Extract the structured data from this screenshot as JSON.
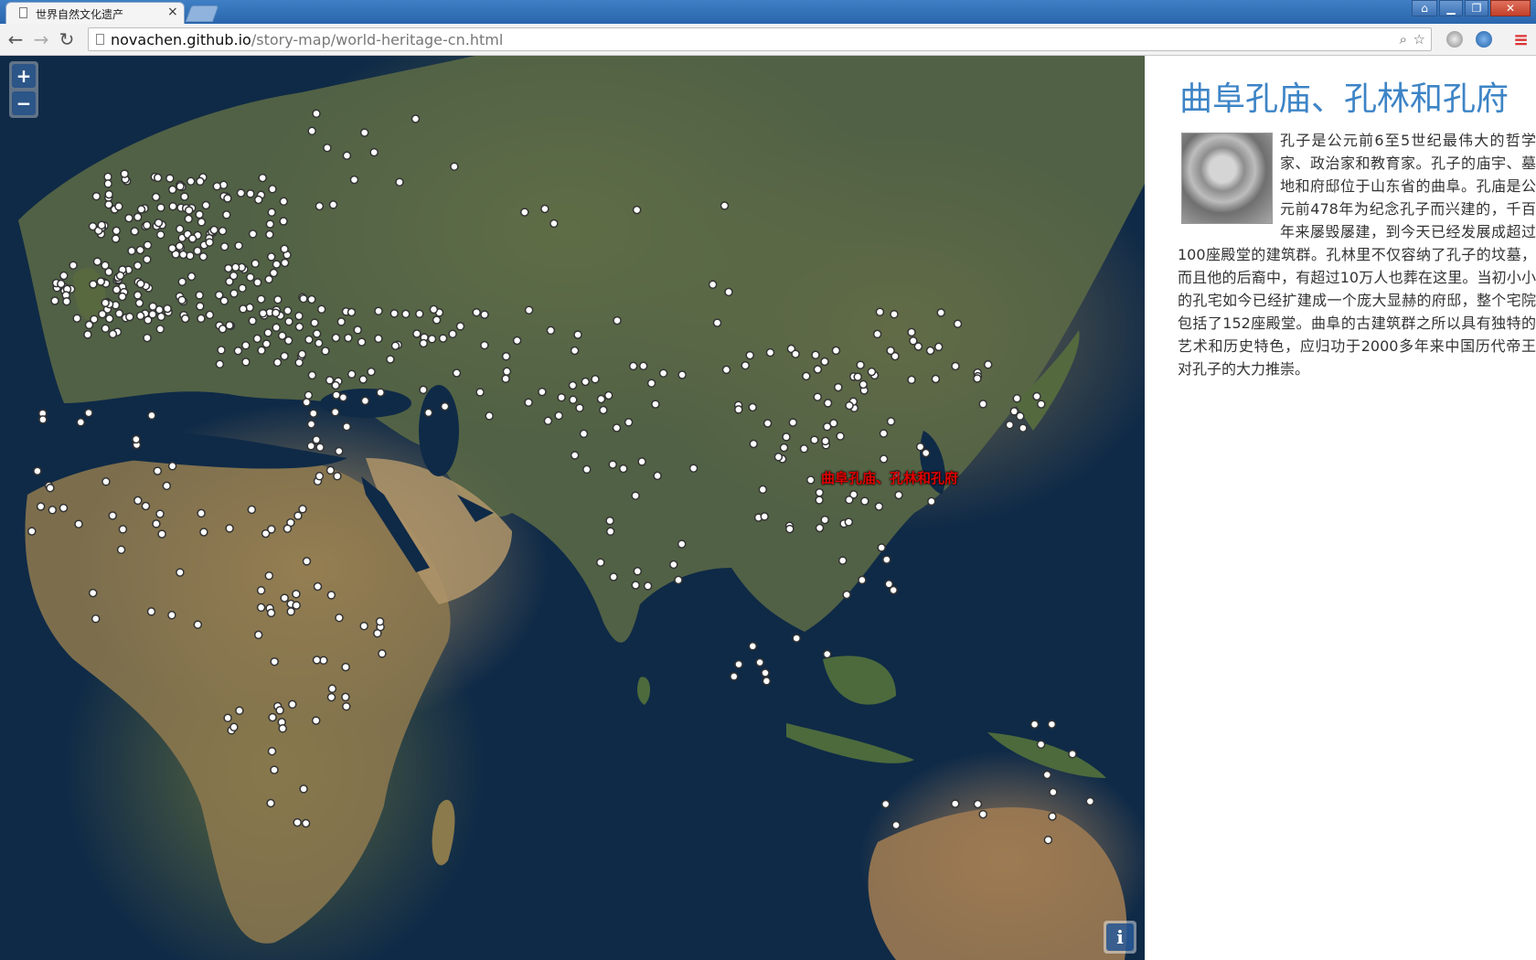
{
  "browser": {
    "tab_title": "世界自然文化遗产",
    "tab_close": "×",
    "url_host": "novachen.github.io",
    "url_path": "/story-map/world-heritage-cn.html"
  },
  "map": {
    "zoom_in_label": "+",
    "zoom_out_label": "−",
    "info_label": "i",
    "selected_label": "曲阜孔庙、孔林和孔府"
  },
  "sidebar": {
    "title": "曲阜孔庙、孔林和孔府",
    "body": "孔子是公元前6至5世纪最伟大的哲学家、政治家和教育家。孔子的庙宇、墓地和府邸位于山东省的曲阜。孔庙是公元前478年为纪念孔子而兴建的，千百年来屡毁屡建，到今天已经发展成超过100座殿堂的建筑群。孔林里不仅容纳了孔子的坟墓，而且他的后裔中，有超过10万人也葬在这里。当初小小的孔宅如今已经扩建成一个庞大显赫的府邸，整个宅院包括了152座殿堂。曲阜的古建筑群之所以具有独特的艺术和历史特色，应归功于2000多年来中国历代帝王对孔子的大力推崇。"
  }
}
